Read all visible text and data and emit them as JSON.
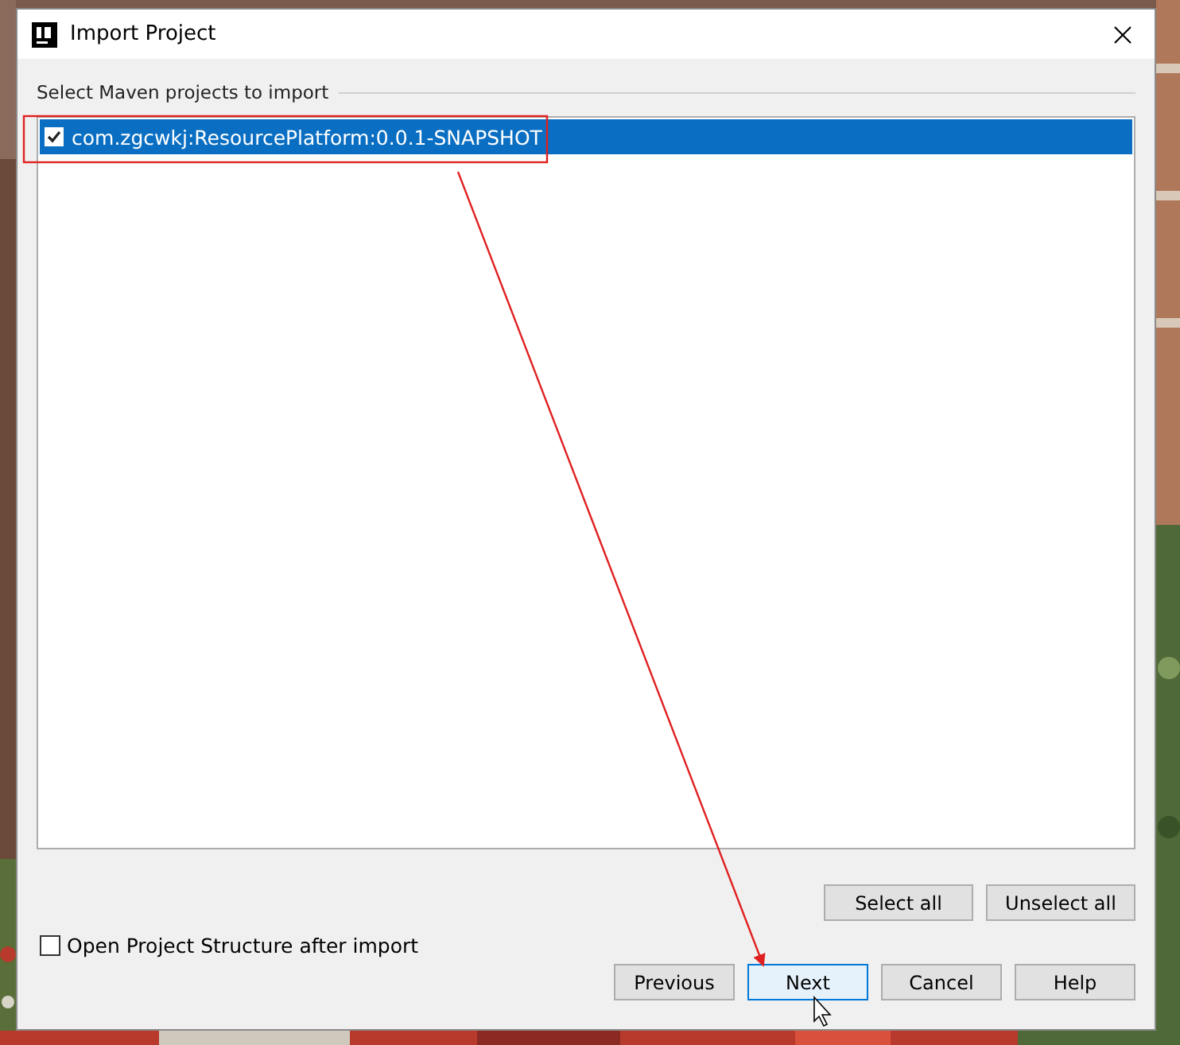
{
  "window": {
    "title": "Import Project"
  },
  "section_label": "Select Maven projects to import",
  "projects": [
    {
      "label": "com.zgcwkj:ResourcePlatform:0.0.1-SNAPSHOT",
      "checked": true,
      "selected": true
    }
  ],
  "list_buttons": [
    {
      "label": "Select all",
      "focused": false
    },
    {
      "label": "Unselect all",
      "focused": false
    }
  ],
  "option": {
    "label": "Open Project Structure after import",
    "checked": false
  },
  "buttons": [
    {
      "label": "Previous",
      "focused": false
    },
    {
      "label": "Next",
      "focused": true
    },
    {
      "label": "Cancel",
      "focused": false
    },
    {
      "label": "Help",
      "focused": false
    }
  ]
}
